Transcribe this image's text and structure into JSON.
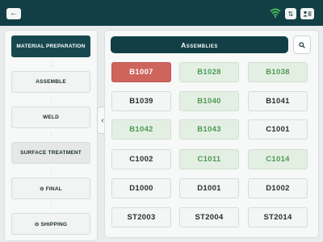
{
  "topbar": {
    "back_icon": "arrow-left-icon",
    "wifi_icon": "wifi-icon",
    "wifi_color": "#4cc45a",
    "sync_icon": "sync-icon",
    "user_icon": "user-card-icon"
  },
  "steps": [
    {
      "label": "MATERIAL PREPARATION",
      "state": "active"
    },
    {
      "label": "ASSEMBLE",
      "state": "normal"
    },
    {
      "label": "WELD",
      "state": "normal"
    },
    {
      "label": "SURFACE TREATMENT",
      "state": "gray"
    },
    {
      "label": "⊝ FINAL",
      "state": "normal"
    },
    {
      "label": "⊝ SHIPPING",
      "state": "normal"
    }
  ],
  "main": {
    "header": "Assemblies",
    "search_icon": "search-icon"
  },
  "tiles": [
    {
      "label": "B1007",
      "status": "red"
    },
    {
      "label": "B1028",
      "status": "green"
    },
    {
      "label": "B1038",
      "status": "green"
    },
    {
      "label": "B1039",
      "status": "white"
    },
    {
      "label": "B1040",
      "status": "green"
    },
    {
      "label": "B1041",
      "status": "white"
    },
    {
      "label": "B1042",
      "status": "green"
    },
    {
      "label": "B1043",
      "status": "green"
    },
    {
      "label": "C1001",
      "status": "white"
    },
    {
      "label": "C1002",
      "status": "white"
    },
    {
      "label": "C1011",
      "status": "green"
    },
    {
      "label": "C1014",
      "status": "green"
    },
    {
      "label": "D1000",
      "status": "white"
    },
    {
      "label": "D1001",
      "status": "white"
    },
    {
      "label": "D1002",
      "status": "white"
    },
    {
      "label": "ST2003",
      "status": "white"
    },
    {
      "label": "ST2004",
      "status": "white"
    },
    {
      "label": "ST2014",
      "status": "white"
    }
  ],
  "colors": {
    "primary": "#123f45",
    "red": "#cf645c",
    "green_text": "#4c9a52",
    "green_bg": "#e4efe4"
  }
}
